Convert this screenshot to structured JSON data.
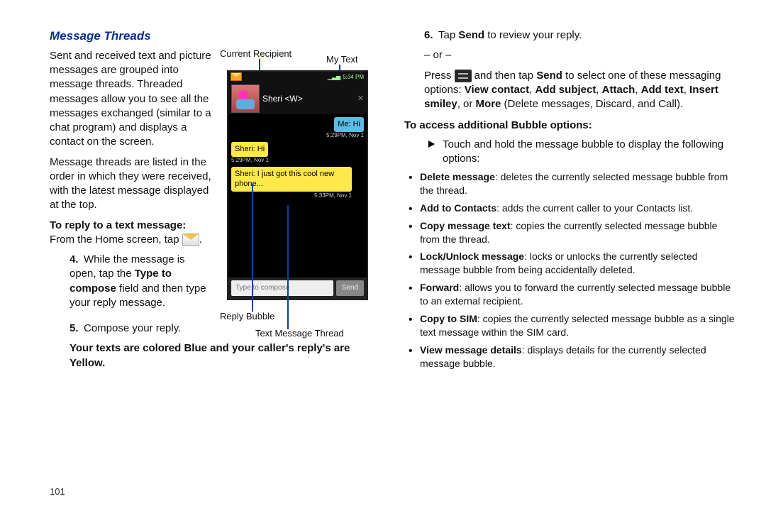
{
  "heading": "Message Threads",
  "left": {
    "p1": "Sent and received text and picture messages are grouped into message threads. Threaded messages allow you to see all the messages exchanged (similar to a chat program) and displays a contact on the screen.",
    "p2": "Message threads are listed in the order in which they were received, with the latest message displayed at the top.",
    "reply_lead_b": "To reply to a text message:",
    "reply_lead_rest": " From the Home screen, tap ",
    "reply_lead_end": ".",
    "step4_a": "While the message is open, tap the ",
    "step4_b": "Type to compose",
    "step4_c": " field and then type your reply message.",
    "step5": "Compose your reply.",
    "note": "Your texts are colored Blue and your caller's reply's are Yellow.",
    "n4": "4.",
    "n5": "5."
  },
  "figure": {
    "lbl_current_recipient": "Current Recipient",
    "lbl_my_text": "My Text",
    "lbl_reply_bubble": "Reply Bubble",
    "lbl_text_thread": "Text Message Thread",
    "status_time": "5:34 PM",
    "recipient": "Sheri <W>",
    "msg_me": "Me: Hi",
    "msg_me_ts": "5:29PM, Nov 1",
    "msg_them1": "Sheri: Hi",
    "msg_them1_ts": "5:29PM, Nov 1",
    "msg_them2": "Sheri: I just got this cool new phone...",
    "msg_them2_ts": "5:33PM, Nov 1",
    "compose_placeholder": "Type to compose",
    "send": "Send"
  },
  "right": {
    "n6": "6.",
    "step6_a": "Tap ",
    "step6_b": "Send",
    "step6_c": " to review your reply.",
    "or": "– or –",
    "press_a": "Press ",
    "press_b": " and then tap ",
    "press_send": "Send",
    "press_c": " to select one of these messaging options: ",
    "opt_view_contact": "View contact",
    "opt_add_subject": "Add subject",
    "opt_attach": "Attach",
    "opt_add_text": "Add text",
    "opt_insert_smiley": "Insert smiley",
    "opt_more_a": ", or ",
    "opt_more_b": "More",
    "opt_more_c": " (Delete messages, Discard, and Call).",
    "sec_head": "To access additional Bubble options:",
    "tri": "Touch and hold the message bubble to display the following options:",
    "bl": [
      {
        "b": "Delete message",
        "t": ": deletes the currently selected message bubble from the thread."
      },
      {
        "b": "Add to Contacts",
        "t": ": adds the current caller to your Contacts list."
      },
      {
        "b": "Copy message text",
        "t": ": copies the currently selected message bubble from the thread."
      },
      {
        "b": "Lock/Unlock message",
        "t": ": locks or unlocks the currently selected message bubble from being accidentally deleted."
      },
      {
        "b": "Forward",
        "t": ": allows you to forward the currently selected message bubble to an external recipient."
      },
      {
        "b": "Copy to SIM",
        "t": ": copies the currently selected message bubble as a single text message within the SIM card."
      },
      {
        "b": "View message details",
        "t": ": displays details for the currently selected message bubble."
      }
    ]
  },
  "page_num": "101",
  "sep": ", "
}
